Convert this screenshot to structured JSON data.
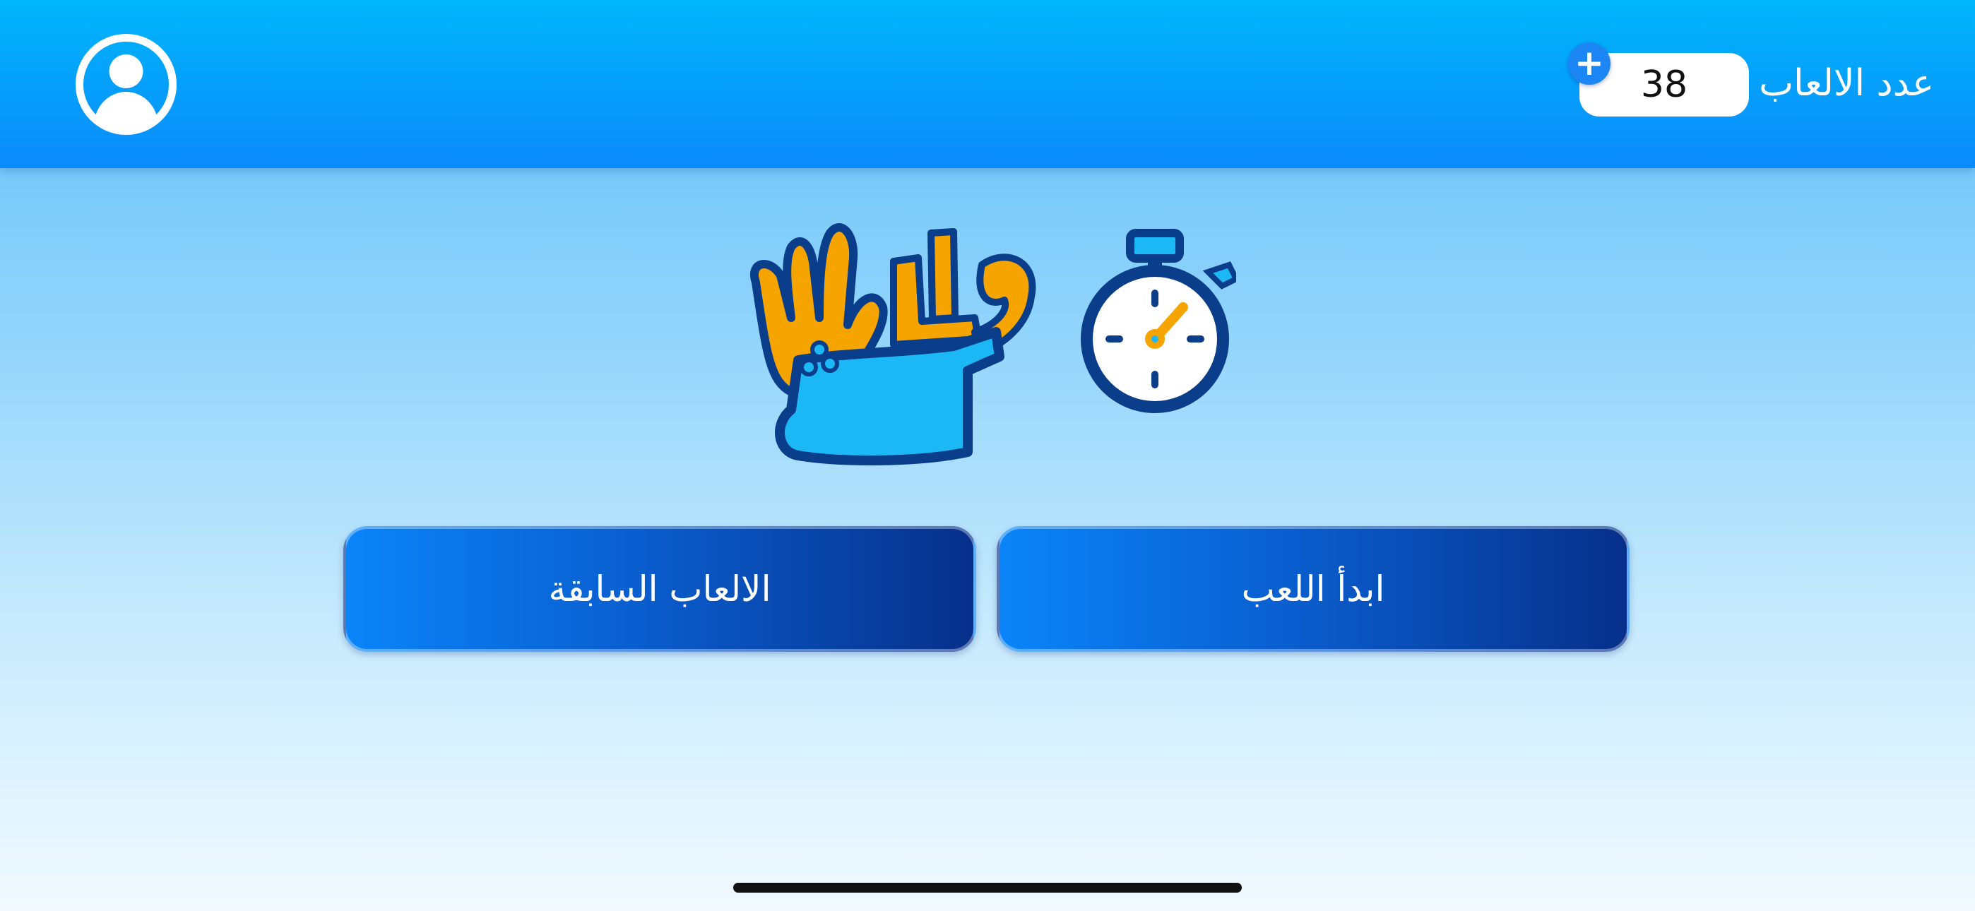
{
  "header": {
    "games_label": "عدد الالعاب",
    "games_count": "38",
    "add_icon": "plus-icon",
    "profile_icon": "user-circle-icon"
  },
  "logo": {
    "line1": "ولدي",
    "line2": "كلمة",
    "icons": [
      "waving-hand-icon",
      "stopwatch-icon"
    ]
  },
  "actions": {
    "start_label": "ابدأ اللعب",
    "previous_label": "الالعاب السابقة"
  },
  "colors": {
    "header_top": "#00b6fb",
    "header_bottom": "#0a8afb",
    "button_light": "#0a85f8",
    "button_dark": "#07308a",
    "logo_orange": "#f6a500",
    "logo_cyan": "#1cb8f5",
    "logo_navy": "#0a3d8a"
  }
}
